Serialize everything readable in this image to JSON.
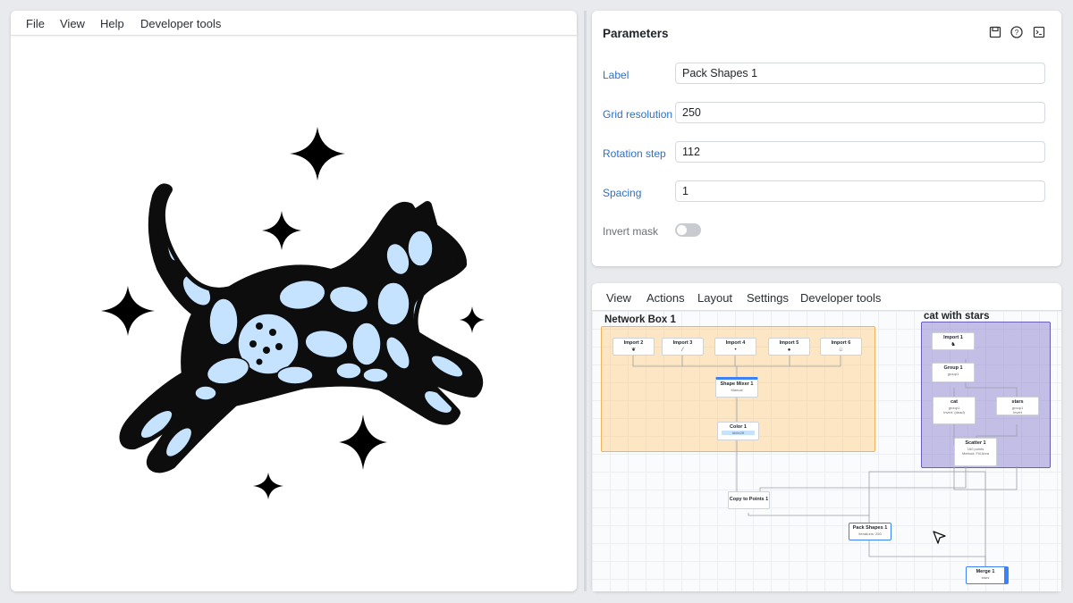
{
  "menu": {
    "file": "File",
    "view": "View",
    "help": "Help",
    "devtools": "Developer tools"
  },
  "icons": {
    "sparkle": "four-point-star-icon",
    "cat": "cat-silhouette-icon"
  },
  "colors": {
    "accent": "#2f6fc8",
    "shape_fill": "#c5e3ff",
    "outline": "#0d0d0d",
    "network_box": "#ffd9a8",
    "cat_box": "#b9b4e6"
  },
  "params": {
    "title": "Parameters",
    "label": {
      "label": "Label",
      "value": "Pack Shapes 1"
    },
    "grid": {
      "label": "Grid resolution",
      "value": "250"
    },
    "rotation": {
      "label": "Rotation step",
      "value": "112"
    },
    "spacing": {
      "label": "Spacing",
      "value": "1"
    },
    "invert": {
      "label": "Invert mask",
      "enabled": false
    }
  },
  "network": {
    "menu": {
      "view": "View",
      "actions": "Actions",
      "layout": "Layout",
      "settings": "Settings",
      "devtools": "Developer tools"
    },
    "box1_title": "Network Box 1",
    "box2_title": "cat with stars",
    "nodes": {
      "import2": "Import 2",
      "import3": "Import 3",
      "import4": "Import 4",
      "import5": "Import 5",
      "import6": "Import 6",
      "mixer": "Shape Mixer 1",
      "mixer_sub": "Manual",
      "color": "Color 1",
      "color_sub": "#b9e2ff",
      "copy": "Copy to Points 1",
      "pack": "Pack Shapes 1",
      "pack_sub": "Iterations: 250",
      "import1": "Import 1",
      "group": "Group 1",
      "group_sub": "group1",
      "cat": "cat",
      "cat_sub1": "group1",
      "cat_sub2": "Invert: (dead)",
      "stars": "stars",
      "stars_sub1": "group1",
      "stars_sub2": "Invert",
      "scatter": "Scatter 1",
      "scatter_sub1": "160 points",
      "scatter_sub2": "Method: Fill Area",
      "merge": "Merge 1",
      "merge_sub": "stars"
    }
  }
}
